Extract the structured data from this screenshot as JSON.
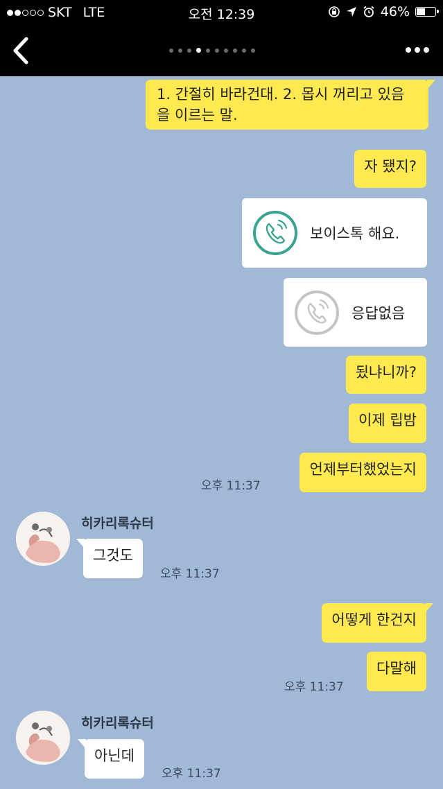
{
  "status_bar": {
    "carrier": "SKT",
    "network": "LTE",
    "time": "오전 12:39",
    "battery": "46%",
    "battery_level": 0.46
  },
  "nav": {
    "page_count": 10,
    "active_page": 4
  },
  "messages": [
    {
      "side": "out",
      "text": "1. 간절히 바라건대. 2. 몹시 꺼리고 있음을 이르는 말."
    },
    {
      "side": "out",
      "text": "자 됐지?"
    },
    {
      "side": "out",
      "type": "call",
      "text": "보이스톡 해요.",
      "icon": "voice-call-icon",
      "color": "#3aa390"
    },
    {
      "side": "out",
      "type": "call",
      "text": "응답없음",
      "icon": "voice-call-missed-icon",
      "color": "#c4c4c4"
    },
    {
      "side": "out",
      "text": "됬냐니까?"
    },
    {
      "side": "out",
      "text": "이제 립밤"
    },
    {
      "side": "out",
      "text": "언제부터했었는지",
      "time": "오후 11:37"
    },
    {
      "side": "in",
      "sender": "히카리록슈터",
      "text": "그것도",
      "time": "오후 11:37"
    },
    {
      "side": "out",
      "text": "어떻게 한건지"
    },
    {
      "side": "out",
      "text": "다말해",
      "time": "오후 11:37"
    },
    {
      "side": "in",
      "sender": "히카리록슈터",
      "text": "아닌데",
      "time": "오후 11:37"
    }
  ],
  "colors": {
    "background": "#a1b9d6",
    "outgoing_bubble": "#fee951",
    "incoming_bubble": "#ffffff"
  }
}
